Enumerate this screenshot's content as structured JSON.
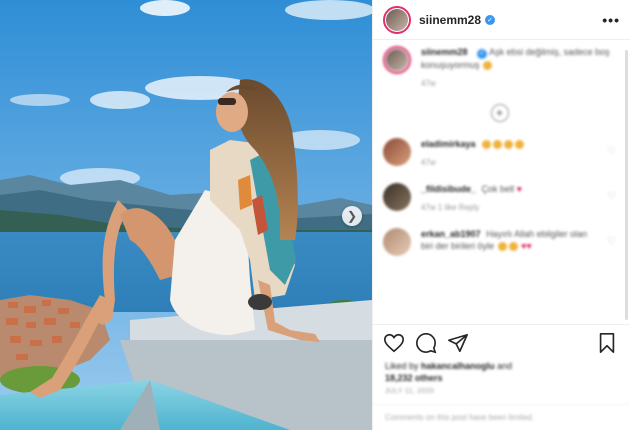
{
  "post": {
    "username": "siinemm28",
    "verified_mark": "✓",
    "more_label": "•••",
    "caption_user": "siinemm28",
    "caption_text": "Aşk ebsi değilmiş, sadece boş konuşuyormuş",
    "caption_age": "47w"
  },
  "comments": [
    {
      "user": "eladimirkaya",
      "text": "",
      "meta": "47w",
      "emoji_count": 4,
      "hearts": 0
    },
    {
      "user": "_fildisibude_",
      "text": "Çok bell",
      "meta": "47w   1 like   Reply",
      "emoji_count": 0,
      "hearts": 1
    },
    {
      "user": "erkan_ab1907",
      "text": "Hayırlı Allah ebilgiler olan biri der birileri öyle",
      "meta": "",
      "emoji_count": 2,
      "hearts": 2
    }
  ],
  "likes": {
    "prefix": "Liked by",
    "user": "hakancalhanoglu",
    "middle": "and",
    "count": "18,232 others"
  },
  "date": "JULY 11, 2020",
  "add_comment_placeholder": "Comments on this post have been limited.",
  "colors": {
    "accent": "#3897f0",
    "ring": "#e1306c",
    "heart": "#e0245e"
  },
  "icons": [
    "heart-icon",
    "comment-icon",
    "share-icon",
    "bookmark-icon",
    "chevron-right-icon",
    "more-icon",
    "verified-icon",
    "plus-icon"
  ]
}
